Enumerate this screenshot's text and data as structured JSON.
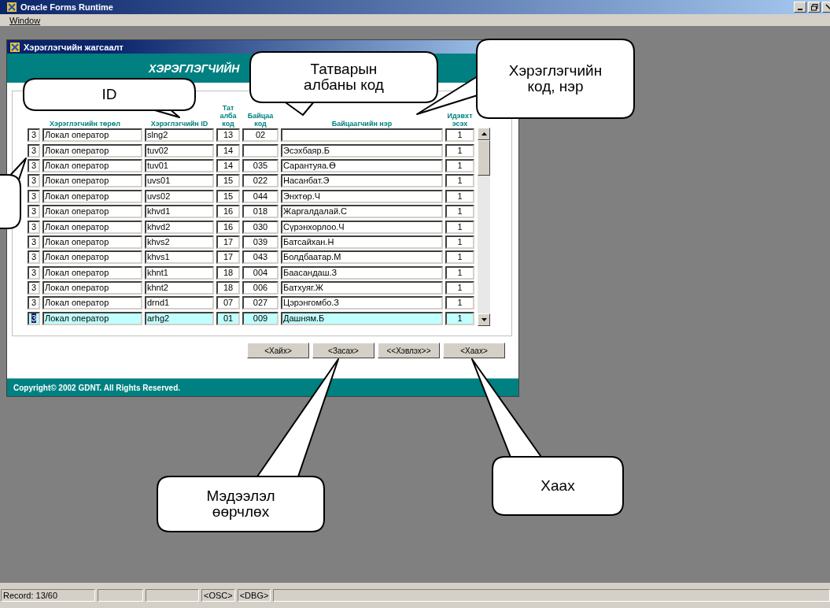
{
  "app_title": "Oracle Forms Runtime",
  "menu": [
    "Window"
  ],
  "form": {
    "window_title": "Хэрэглэгчийн жагсаалт",
    "heading": "ХЭРЭГЛЭГЧИЙН",
    "columns": [
      {
        "label": "Хэрэглэгчийн төрөл"
      },
      {
        "label": "Хэрэглэгчийн ID"
      },
      {
        "label": "Тат алба код"
      },
      {
        "label": "Байцаа код"
      },
      {
        "label": "Байцаагчийн нэр"
      },
      {
        "label": "Идэвхт эсэх"
      }
    ],
    "rows": [
      {
        "type_code": "3",
        "type": "Локал оператор",
        "id": "slng2",
        "tax_office": "13",
        "inspector_code": "02",
        "active": "1",
        "selected": false
      },
      {
        "type_code": "3",
        "type": "Локал оператор",
        "id": "tuv02",
        "tax_office": "14",
        "inspector_name": "Эсэхбаяр.Б",
        "active": "1",
        "selected": false
      },
      {
        "type_code": "3",
        "type": "Локал оператор",
        "id": "tuv01",
        "tax_office": "14",
        "inspector_code": "035",
        "inspector_name": "Сарантуяа.Ө",
        "active": "1",
        "selected": false
      },
      {
        "type_code": "3",
        "type": "Локал оператор",
        "id": "uvs01",
        "tax_office": "15",
        "inspector_code": "022",
        "inspector_name": "Насанбат.Э",
        "active": "1",
        "selected": false
      },
      {
        "type_code": "3",
        "type": "Локал оператор",
        "id": "uvs02",
        "tax_office": "15",
        "inspector_code": "044",
        "inspector_name": "Энхтөр.Ч",
        "active": "1",
        "selected": false
      },
      {
        "type_code": "3",
        "type": "Локал оператор",
        "id": "khvd1",
        "tax_office": "16",
        "inspector_code": "018",
        "inspector_name": "Жаргалдалай.С",
        "active": "1",
        "selected": false
      },
      {
        "type_code": "3",
        "type": "Локал оператор",
        "id": "khvd2",
        "tax_office": "16",
        "inspector_code": "030",
        "inspector_name": "Сүрэнхорлоо.Ч",
        "active": "1",
        "selected": false
      },
      {
        "type_code": "3",
        "type": "Локал оператор",
        "id": "khvs2",
        "tax_office": "17",
        "inspector_code": "039",
        "inspector_name": "Батсайхан.Н",
        "active": "1",
        "selected": false
      },
      {
        "type_code": "3",
        "type": "Локал оператор",
        "id": "khvs1",
        "tax_office": "17",
        "inspector_code": "043",
        "inspector_name": "Болдбаатар.М",
        "active": "1",
        "selected": false
      },
      {
        "type_code": "3",
        "type": "Локал оператор",
        "id": "khnt1",
        "tax_office": "18",
        "inspector_code": "004",
        "inspector_name": "Баасандаш.З",
        "active": "1",
        "selected": false
      },
      {
        "type_code": "3",
        "type": "Локал оператор",
        "id": "khnt2",
        "tax_office": "18",
        "inspector_code": "006",
        "inspector_name": "Батхуяг.Ж",
        "active": "1",
        "selected": false
      },
      {
        "type_code": "3",
        "type": "Локал оператор",
        "id": "drnd1",
        "tax_office": "07",
        "inspector_code": "027",
        "inspector_name": "Цэрэнгомбо.З",
        "active": "1",
        "selected": false
      },
      {
        "type_code": "3",
        "type": "Локал оператор",
        "id": "arhg2",
        "tax_office": "01",
        "inspector_code": "009",
        "inspector_name": "Дашням.Б",
        "active": "1",
        "selected": true
      }
    ],
    "buttons": [
      "<Хайх>",
      "<Засах>",
      "<<Хэвлэх>>",
      "<Хаах>"
    ],
    "copyright": "Copyright© 2002 GDNT. All Rights Reserved."
  },
  "status_bar": {
    "record": "Record: 13/60",
    "osc": "<OSC>",
    "dbg": "<DBG>"
  },
  "callouts": [
    {
      "lines": [
        "ID"
      ]
    },
    {
      "lines": [
        "Татварын",
        "албаны код"
      ]
    },
    {
      "lines": [
        "Хэрэглэгчийн",
        "код, нэр"
      ]
    },
    {
      "lines": [
        "Мэдээлэл",
        "өөрчлөх"
      ]
    },
    {
      "lines": [
        "Хаах"
      ]
    }
  ]
}
